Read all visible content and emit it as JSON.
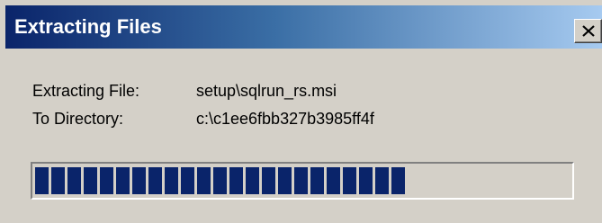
{
  "window": {
    "title": "Extracting Files",
    "close_glyph": "✕"
  },
  "details": {
    "file_label": "Extracting File:",
    "file_value": "setup\\sqlrun_rs.msi",
    "dir_label": "To Directory:",
    "dir_value": "c:\\c1ee6fbb327b3985ff4f"
  },
  "progress": {
    "fraction": 0.69,
    "segments_filled": 23,
    "color": "#0a246a"
  },
  "icons": {
    "close": "close-icon"
  }
}
